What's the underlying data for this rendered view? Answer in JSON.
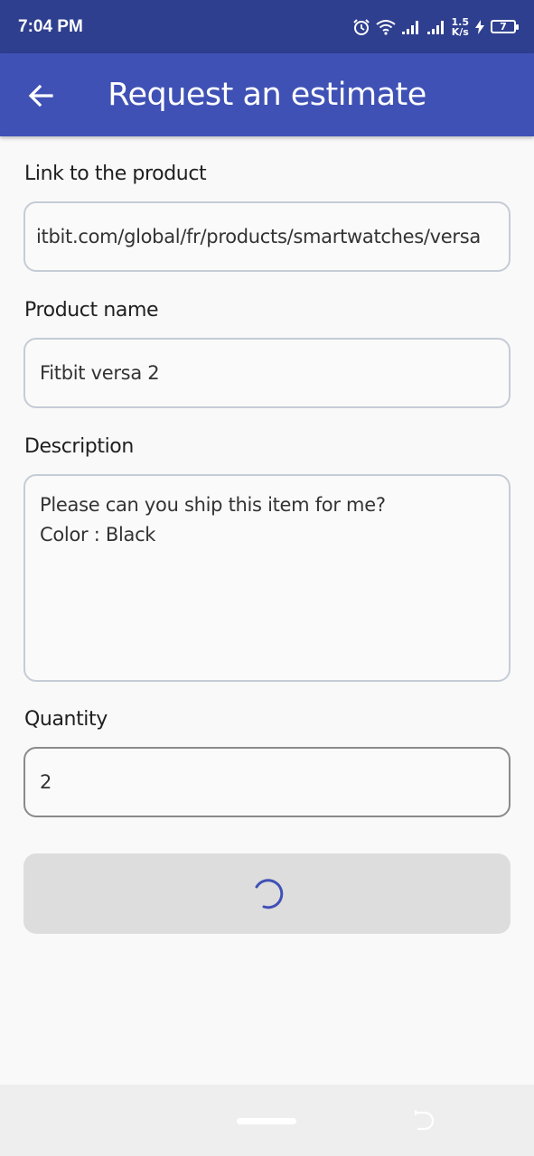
{
  "status_bar": {
    "time": "7:04 PM",
    "network_speed_value": "1.5",
    "network_speed_unit": "K/s",
    "battery_level": "7"
  },
  "app_bar": {
    "title": "Request an estimate",
    "back_icon": "arrow-back-icon"
  },
  "form": {
    "link_label": "Link to the product",
    "link_value": "itbit.com/global/fr/products/smartwatches/versa",
    "name_label": "Product name",
    "name_value": "Fitbit versa 2",
    "description_label": "Description",
    "description_lines": [
      "Please can you ship this item for me?",
      "Color : Black"
    ],
    "quantity_label": "Quantity",
    "quantity_value": "2"
  },
  "submit": {
    "state": "loading",
    "spinner_icon": "loading-spinner-icon"
  },
  "colors": {
    "status_bar": "#2e3f8f",
    "app_bar": "#3f51b5",
    "spinner": "#3f51b5",
    "button_bg": "#dddddd"
  }
}
